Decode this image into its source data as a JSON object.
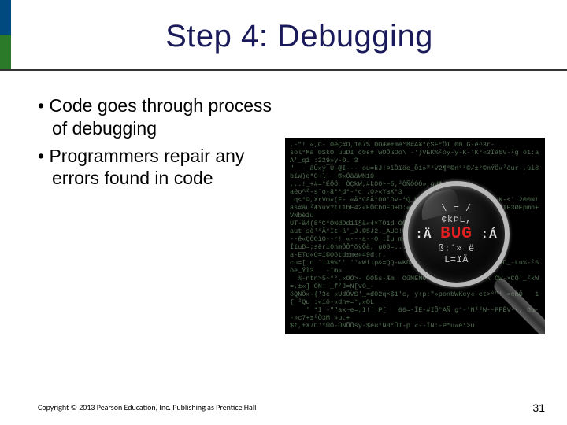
{
  "title": "Step 4: Debugging",
  "bullets": [
    "Code goes through process of debugging",
    "Programmers repair any errors found in code"
  ],
  "image": {
    "alt": "Magnifying glass over green code revealing the word BUG in red",
    "lens_line_top": "\\ = /",
    "lens_line_kpl": "¢kÞL,   ",
    "lens_bug_pre": ":Ä ",
    "lens_bug_word": "BUG",
    "lens_bug_post": " :Á",
    "lens_line_mid": "ß:´»  ë   ",
    "lens_line_bot": "   L=ïÄ   "
  },
  "footer": {
    "copyright": "Copyright © 2013 Pearson Education, Inc. Publishing as Prentice Hall",
    "page": "31"
  },
  "code_noise": ".-\"! «,C- 0èÇ#O,167% DOÆæ±mé°8#A¥°çSF°ÖI 00 G-é^3r-\nsöl°Mã 0SkO uuDI c0s# wOÔßOo\\ -'}VEK%²oý-y-K-'K°«3Ïá5V-²g ö1:aA'_q1 :229»y-0. 3\n\"  - äÜ»ý¯Ù-@I·-- ou=kJ!ÞîÒïöe_Õi»\"°V2¶°©n°°©/±°©nÝÖ»²öur-,ùi8bïW)e*O-l   ®«ÓääWN10\n,..!_+#=°ÉÔÖ  ÒÇkW,#k00~~5,²ÒÑÓÓÓ»,gU*WÞo^. 4\naéo^²-s´o-ã°°d°-°c .0>«YaX°3\n q<°©,XrVm«(E- «Ä°CâÄ°00'DV-°Q_K-0   . --E:-6--±: 8-K-<' 200N!\nas#äu²ÆYuv?tI1bE42«EÔCbOED+D:«duDE7²öú°®4®,³@aEkj4It²IE3ØEpmn+VNbè1u\nÜT-ä4(8°C°ÔNdDd1î§ä«4×TÖ1d Ô0+°Ow   ´ý#orAG\naut sè'°Ä*It-ä'_J.©5J2._AUC!ÙOdaò0×.-  Yöu\n--ê«ÇÒOïO--r! «---a--0 :Îu m«Wq°\nÎíuD=;sèr±0nmÓÔ*ôÿÕä, g00=...=aqÎ\na-ETq«O=í©Oótd±me«49d.r.\ncu=[ o ´139%'' ''«Wi1p&=QQ-wKD490-u«3     Ý+-© h «AueD_-Lu%-²6öe_ÝÌ3   -Im«\n  %-ntn>5~°°.«OÓ>- Ô05s-Æm  ÒűNENÒ ©' °NÔdDÖ6-A²-\\ ÒW-×CÒ'_²kW=,±«] ÖN!'_f²J=N[vÓ_-\nöQNÖ»-{'3c «UdÖVS'_=d02q×$1'c, y+p:\"»ponbWKcy«-ct>°\"! =cmÔ   1{ ²Qu :«íö-«dn+=°,»OL\n    ' *I -\"\"ax~e=,I!'_P[   66=-ÎE-#IÕ°AÑ g°-'N²²W--PFÈV²-, Ou--»c7+±²Ö3M'»u.+\n$t,±X7C'°ÙÓ-ÚNÕÔsy-$ëû°N0°ÛI-p «--ÏN:-P*u«è°>u"
}
